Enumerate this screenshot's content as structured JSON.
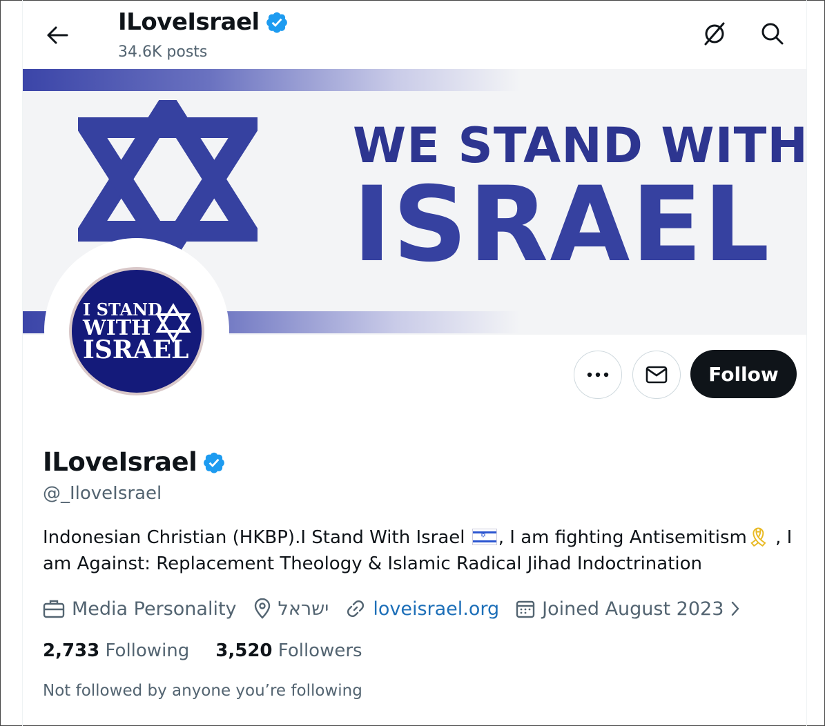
{
  "header": {
    "display_name": "ILoveIsrael",
    "posts_count": "34.6K posts"
  },
  "banner": {
    "line1": "WE STAND WITH",
    "line2": "ISRAEL"
  },
  "avatar": {
    "line1": "I STAND",
    "line2": "WITH",
    "line3": "ISRAEL"
  },
  "actions": {
    "more_label": "•••",
    "follow_label": "Follow"
  },
  "profile": {
    "display_name": "ILoveIsrael",
    "handle": "@_IloveIsrael",
    "bio_part1": "Indonesian Christian (HKBP).I Stand With Israel ",
    "bio_part2": ", I am fighting Antisemitism",
    "bio_part3": " , I am Against: Replacement Theology & Islamic Radical Jihad Indoctrination",
    "category": "Media Personality",
    "location": "ישראל",
    "website": "loveisrael.org",
    "joined": "Joined August 2023"
  },
  "stats": {
    "following_count": "2,733",
    "following_label": "Following",
    "followers_count": "3,520",
    "followers_label": "Followers"
  },
  "not_followed_text": "Not followed by anyone you’re following",
  "colors": {
    "verified": "#1d9bf0",
    "banner_blue": "#3641a0",
    "link": "#1d6fb8",
    "follow_bg": "#0f1419"
  }
}
